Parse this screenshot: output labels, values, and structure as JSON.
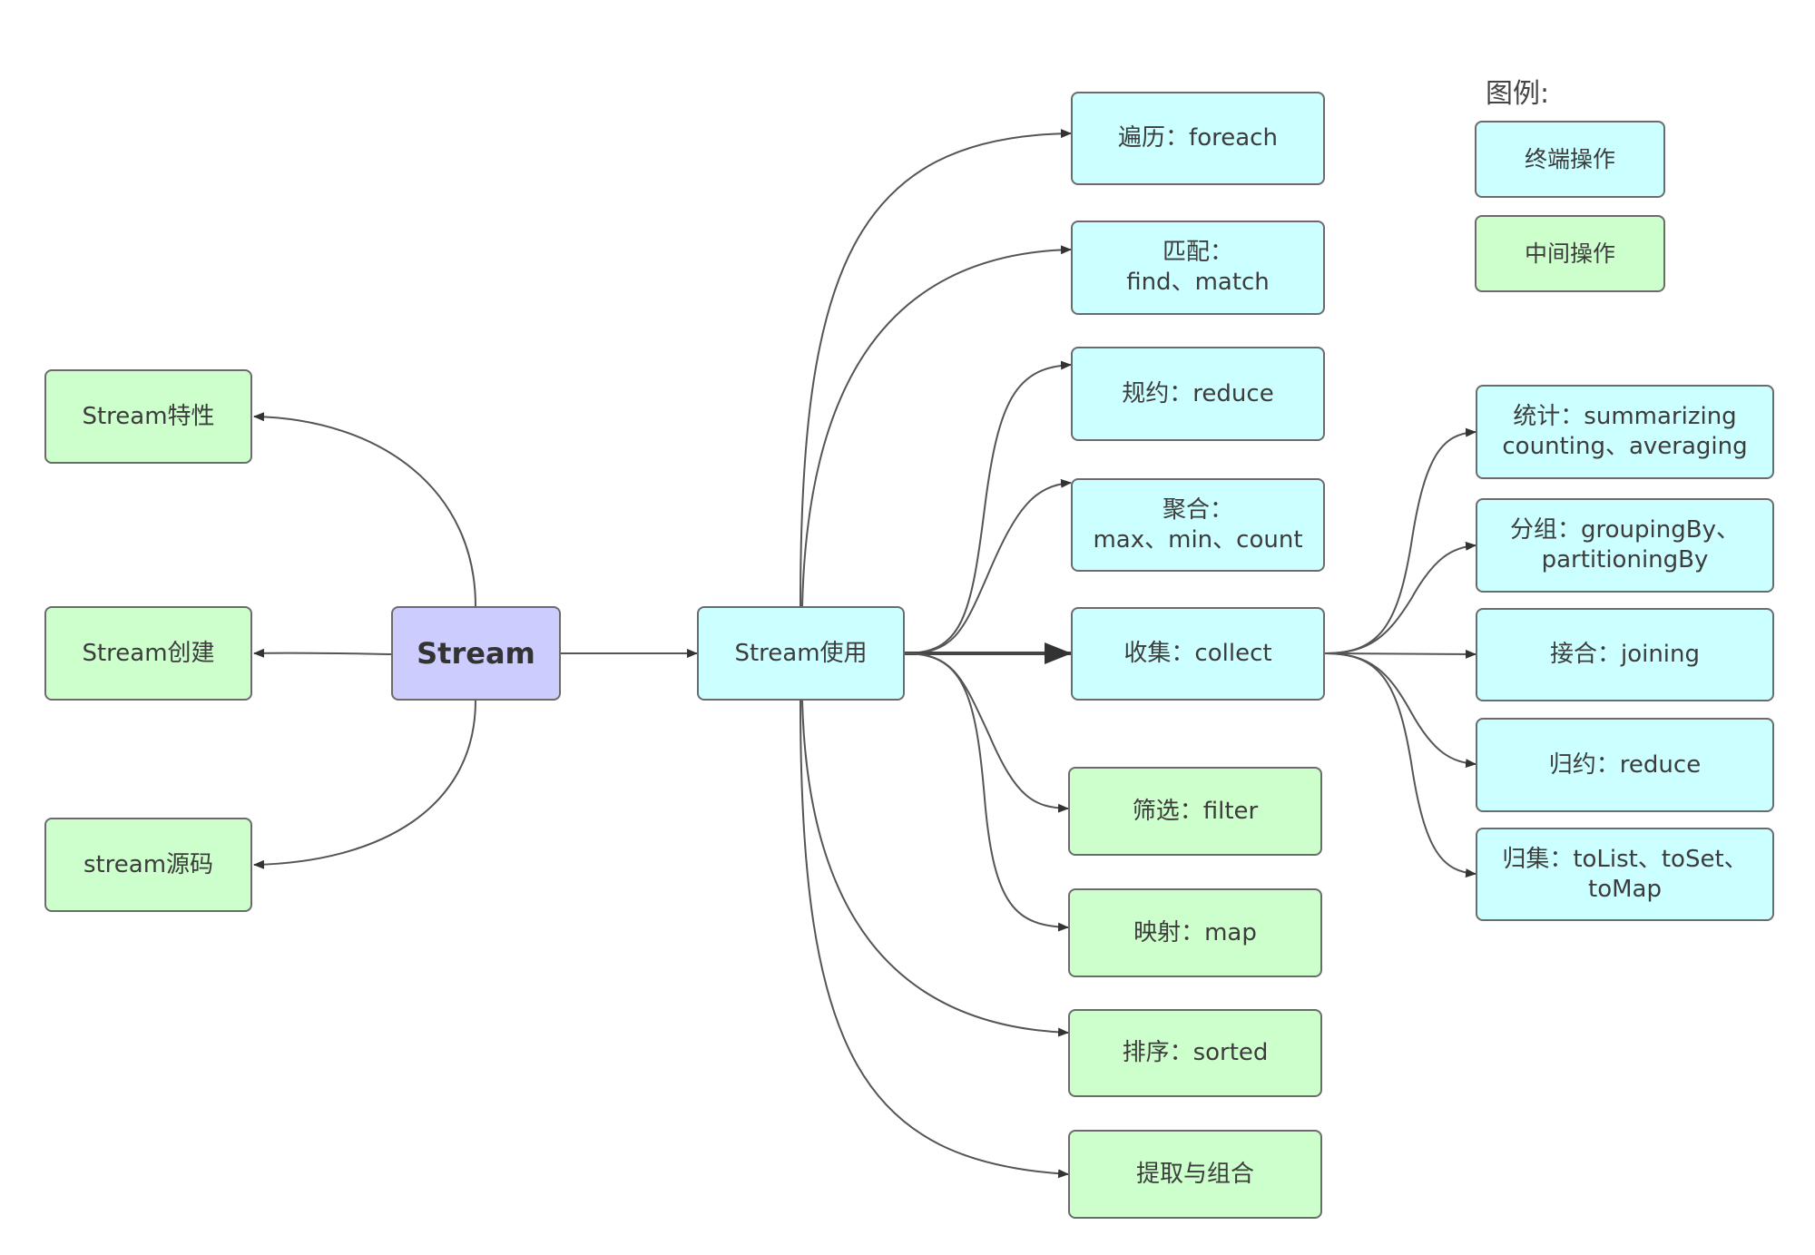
{
  "diagram": {
    "root": {
      "id": "stream",
      "label": "Stream",
      "category": "root"
    },
    "left_children": [
      {
        "id": "features",
        "label": "Stream特性",
        "category": "intermediate"
      },
      {
        "id": "create",
        "label": "Stream创建",
        "category": "intermediate"
      },
      {
        "id": "source",
        "label": "stream源码",
        "category": "intermediate"
      }
    ],
    "usage": {
      "id": "usage",
      "label": "Stream使用",
      "category": "terminal"
    },
    "operations": [
      {
        "id": "foreach",
        "label": "遍历：foreach",
        "category": "terminal"
      },
      {
        "id": "match",
        "label": "匹配：\nfind、match",
        "category": "terminal"
      },
      {
        "id": "reduce",
        "label": "规约：reduce",
        "category": "terminal"
      },
      {
        "id": "aggregate",
        "label": "聚合：\nmax、min、count",
        "category": "terminal"
      },
      {
        "id": "collect",
        "label": "收集：collect",
        "category": "terminal"
      },
      {
        "id": "filter",
        "label": "筛选：filter",
        "category": "intermediate"
      },
      {
        "id": "map",
        "label": "映射：map",
        "category": "intermediate"
      },
      {
        "id": "sorted",
        "label": "排序：sorted",
        "category": "intermediate"
      },
      {
        "id": "extract",
        "label": "提取与组合",
        "category": "intermediate"
      }
    ],
    "collectors": [
      {
        "id": "summarizing",
        "label": "统计：summarizing\ncounting、averaging",
        "category": "terminal"
      },
      {
        "id": "grouping",
        "label": "分组：groupingBy、\npartitioningBy",
        "category": "terminal"
      },
      {
        "id": "joining",
        "label": "接合：joining",
        "category": "terminal"
      },
      {
        "id": "reducing",
        "label": "归约：reduce",
        "category": "terminal"
      },
      {
        "id": "tocollection",
        "label": "归集：toList、toSet、\ntoMap",
        "category": "terminal"
      }
    ],
    "edges": [
      {
        "from": "stream",
        "to": "features"
      },
      {
        "from": "stream",
        "to": "create"
      },
      {
        "from": "stream",
        "to": "source"
      },
      {
        "from": "stream",
        "to": "usage"
      },
      {
        "from": "usage",
        "to": "foreach"
      },
      {
        "from": "usage",
        "to": "match"
      },
      {
        "from": "usage",
        "to": "reduce"
      },
      {
        "from": "usage",
        "to": "aggregate"
      },
      {
        "from": "usage",
        "to": "collect",
        "emphasis": true
      },
      {
        "from": "usage",
        "to": "filter"
      },
      {
        "from": "usage",
        "to": "map"
      },
      {
        "from": "usage",
        "to": "sorted"
      },
      {
        "from": "usage",
        "to": "extract"
      },
      {
        "from": "collect",
        "to": "summarizing"
      },
      {
        "from": "collect",
        "to": "grouping"
      },
      {
        "from": "collect",
        "to": "joining"
      },
      {
        "from": "collect",
        "to": "reducing"
      },
      {
        "from": "collect",
        "to": "tocollection"
      }
    ]
  },
  "legend": {
    "title": "图例:",
    "items": [
      {
        "label": "终端操作",
        "category": "terminal"
      },
      {
        "label": "中间操作",
        "category": "intermediate"
      }
    ]
  },
  "colors": {
    "terminal": "#ccffff",
    "intermediate": "#ccffcc",
    "root": "#ccccff",
    "border": "#6b6b6b",
    "edge": "#555555"
  }
}
